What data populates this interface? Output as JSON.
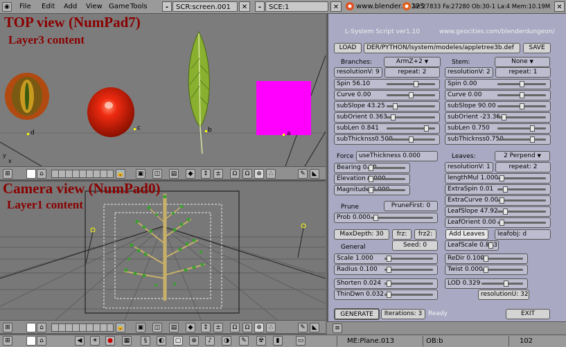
{
  "menubar": {
    "menus": [
      "File",
      "Edit",
      "Add",
      "View",
      "Game",
      "Tools"
    ],
    "screen": "SCR:screen.001",
    "scene": "SCE:1",
    "website": "www.blender.nl 225",
    "stats": "Ve:27833 Fa:27280  Ob:30-1 La:4  Mem:10.19M"
  },
  "top_view": {
    "title": "TOP view (NumPad7)",
    "subtitle": "Layer3 content",
    "object_labels": [
      "d",
      "c",
      "b",
      "a"
    ],
    "axes_labels": [
      "y",
      "x"
    ]
  },
  "cam_view": {
    "title": "Camera view (NumPad0)",
    "subtitle": "Layer1 content"
  },
  "script": {
    "title": "L-System Script ver1.10",
    "url": "www.geocities.com/blenderdungeon/",
    "load_label": "LOAD",
    "path": "DER/PYTHON/lsystem/modeles/appletree3b.def",
    "save_label": "SAVE",
    "branches_label": "Branches:",
    "branches_value": "ArmZ+2",
    "stem_label": "Stem:",
    "stem_value": "None",
    "left_resV": "resolutionV: 9",
    "left_repeat": "repeat: 2",
    "right_resV": "resolutionV: 2",
    "right_repeat": "repeat: 1",
    "left_sliders": [
      {
        "label": "Spin  56.10",
        "pos": 0.62
      },
      {
        "label": "Curve  0.00",
        "pos": 0.5
      },
      {
        "label": "subSlope 43.25",
        "pos": 0.14
      },
      {
        "label": "subOrient  0.363",
        "pos": 0.1
      },
      {
        "label": "subLen 0.841",
        "pos": 0.85
      },
      {
        "label": "subThicknss0.500",
        "pos": 0.5
      }
    ],
    "right_sliders": [
      {
        "label": "Spin  0.00",
        "pos": 0.5
      },
      {
        "label": "Curve  0.00",
        "pos": 0.5
      },
      {
        "label": "subSlope 90.00",
        "pos": 0.5
      },
      {
        "label": "subOrient -23.36",
        "pos": 0.1
      },
      {
        "label": "subLen 0.750",
        "pos": 0.75
      },
      {
        "label": "subThicknss0.750",
        "pos": 0.75
      }
    ],
    "force_label": "Force",
    "force_value": "useThickness 0.000",
    "leaves_label": "Leaves:",
    "leaves_value": "2 Perpend",
    "force_sliders": [
      {
        "label": "Bearing  0.00",
        "pos": 0.05
      },
      {
        "label": "Elevation 0.000",
        "pos": 0.05
      },
      {
        "label": "Magnitude 0.000",
        "pos": 0.05
      }
    ],
    "leaf_resV": "resolutionV: 1",
    "leaf_repeat": "repeat: 2",
    "leaf_sliders": [
      {
        "label": "lengthMul 1.000",
        "pos": 0.05
      },
      {
        "label": "ExtraSpin  0.01",
        "pos": 0.12
      },
      {
        "label": "ExtraCurve  0.00",
        "pos": 0.05
      },
      {
        "label": "LeafSlope 47.92",
        "pos": 0.12
      },
      {
        "label": "LeafOrient 0.00",
        "pos": 0.05
      }
    ],
    "prune_label": "Prune",
    "prune_first": "PruneFirst: 0",
    "prob": {
      "label": "Prob 0.000",
      "pos": 0.05
    },
    "add_leaves": "Add Leaves",
    "leafobj": "leafobj: d",
    "maxdepth": "MaxDepth: 30",
    "frz": "frz:",
    "frz2": "frz2:",
    "seed": "Seed: 0",
    "general_label": "General",
    "leafscale": {
      "label": "LeafScale 0.813",
      "pos": 0.5
    },
    "general_sliders": [
      {
        "label": "Scale  1.000",
        "pos": 0.05
      },
      {
        "label": "Radius  0.100",
        "pos": 0.05
      },
      {
        "label": "Shorten 0.024",
        "pos": 0.05
      },
      {
        "label": "ThinDwn 0.032",
        "pos": 0.05
      }
    ],
    "misc_sliders": [
      {
        "label": "ReDir 0.100",
        "pos": 0.05
      },
      {
        "label": "Twist 0.000",
        "pos": 0.05
      },
      {
        "label": "LOD 0.329",
        "pos": 0.6
      }
    ],
    "resolutionU": "resolutionU: 32",
    "generate": "GENERATE",
    "iterations": "Iterations: 3",
    "status": "Ready",
    "exit": "EXIT"
  },
  "bottombar": {
    "mesh": "ME:Plane.013",
    "object": "OB:b",
    "frame": "102"
  },
  "colors": {
    "panel_bg": "#a9a9c3",
    "title_red": "#8a0000",
    "magenta": "#ff00ff"
  }
}
